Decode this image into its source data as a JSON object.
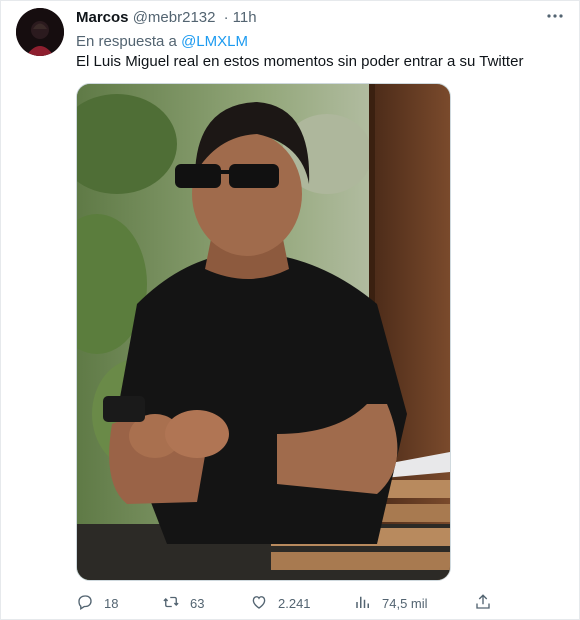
{
  "tweet": {
    "author_name": "Marcos",
    "handle": "@mebr2132",
    "separator": "·",
    "time": "11h",
    "reply_prefix": "En respuesta a",
    "reply_mention": "@LMXLM",
    "text": "El Luis Miguel real en estos momentos sin poder entrar a su Twitter"
  },
  "actions": {
    "replies": "18",
    "retweets": "63",
    "likes": "2.241",
    "views": "74,5 mil"
  },
  "icons": {
    "more": "more-icon",
    "reply": "reply-icon",
    "retweet": "retweet-icon",
    "like": "heart-icon",
    "views": "views-icon",
    "share": "share-icon"
  },
  "colors": {
    "link": "#1d9bf0",
    "secondary_text": "#536471",
    "primary_text": "#0f1419"
  }
}
